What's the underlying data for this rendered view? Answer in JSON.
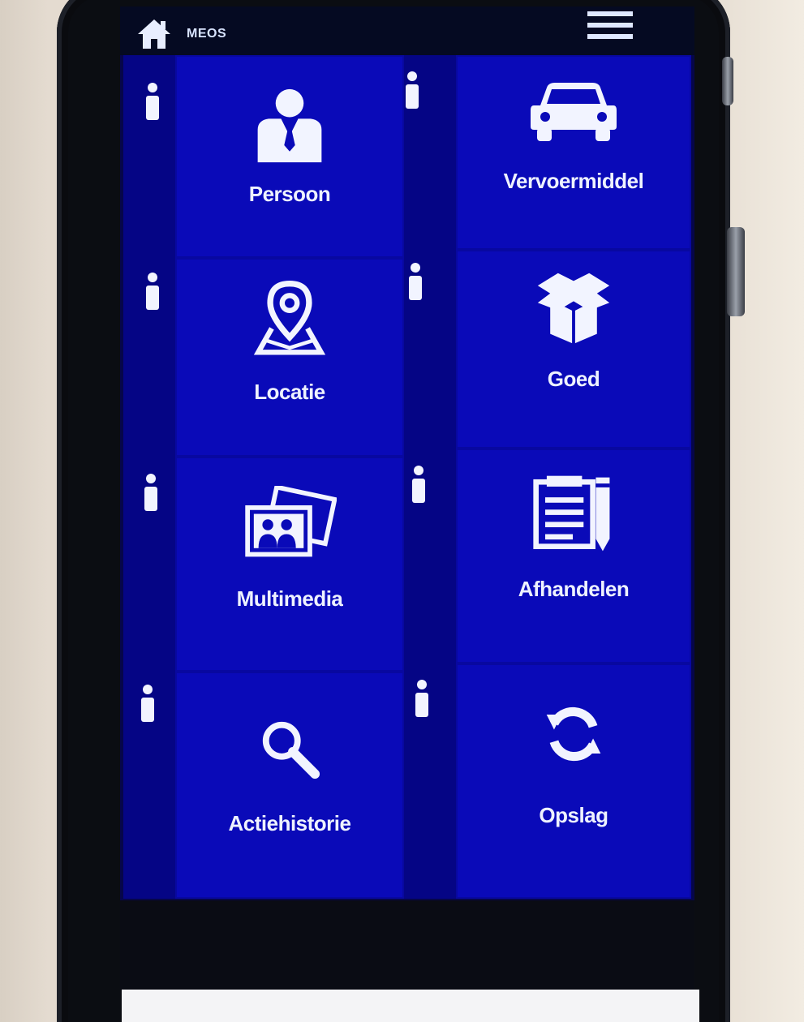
{
  "app": {
    "title": "MEOS"
  },
  "tiles": [
    {
      "label": "Persoon",
      "icon": "person-icon"
    },
    {
      "label": "Vervoermiddel",
      "icon": "car-icon"
    },
    {
      "label": "Locatie",
      "icon": "location-pin-icon"
    },
    {
      "label": "Goed",
      "icon": "box-icon"
    },
    {
      "label": "Multimedia",
      "icon": "photos-icon"
    },
    {
      "label": "Afhandelen",
      "icon": "document-pen-icon"
    },
    {
      "label": "Actiehistorie",
      "icon": "search-icon"
    },
    {
      "label": "Opslag",
      "icon": "refresh-icon"
    }
  ],
  "colors": {
    "tile": "#0a0ab8",
    "info_strip": "#050585",
    "appbar": "#050a22",
    "text": "#eef2ff"
  }
}
